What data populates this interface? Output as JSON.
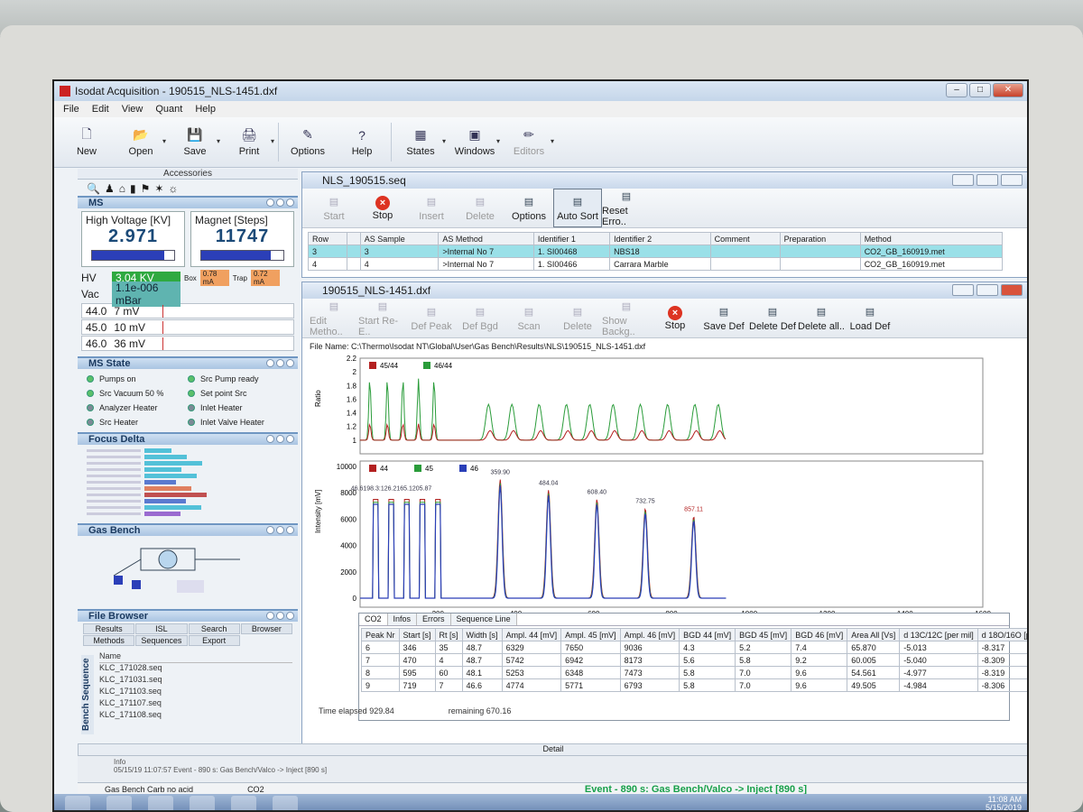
{
  "app": {
    "title": "Isodat Acquisition - 190515_NLS-1451.dxf"
  },
  "menu": [
    "File",
    "Edit",
    "View",
    "Quant",
    "Help"
  ],
  "toolbar": [
    {
      "label": "New",
      "icon": "new-doc-icon",
      "enabled": true
    },
    {
      "label": "Open",
      "icon": "folder-icon",
      "enabled": true
    },
    {
      "label": "Save",
      "icon": "floppy-icon",
      "enabled": true
    },
    {
      "label": "Print",
      "icon": "printer-icon",
      "enabled": true
    },
    {
      "label": "Options",
      "icon": "options-icon",
      "enabled": true
    },
    {
      "label": "Help",
      "icon": "help-icon",
      "enabled": true
    },
    {
      "label": "States",
      "icon": "states-icon",
      "enabled": true
    },
    {
      "label": "Windows",
      "icon": "windows-icon",
      "enabled": true
    },
    {
      "label": "Editors",
      "icon": "pencil-icon",
      "enabled": false
    }
  ],
  "left": {
    "accessories": "Accessories",
    "ms": {
      "title": "MS",
      "hv_label": "High Voltage [KV]",
      "hv_value": "2.971",
      "hv_fill": 0.88,
      "mag_label": "Magnet [Steps]",
      "mag_value": "11747",
      "mag_fill": 0.85,
      "hv_k": "HV",
      "hv_read": "3.04 KV",
      "box_k": "Box",
      "box_v": "0.78 mA",
      "trap_k": "Trap",
      "trap_v": "0.72 mA",
      "vac_k": "Vac",
      "vac_v": "1.1e-006 mBar",
      "lines": [
        {
          "mass": "44.0",
          "val": "7 mV"
        },
        {
          "mass": "45.0",
          "val": "10 mV"
        },
        {
          "mass": "46.0",
          "val": "36 mV"
        }
      ]
    },
    "state": {
      "title": "MS State",
      "items": [
        "Pumps on",
        "Src Pump ready",
        "Src Vacuum 50 %",
        "Set point Src",
        "Analyzer Heater",
        "Inlet Heater",
        "Src Heater",
        "Inlet Valve Heater"
      ]
    },
    "focus": {
      "title": "Focus Delta"
    },
    "gasbench": {
      "title": "Gas Bench"
    },
    "filebrowser": {
      "title": "File Browser",
      "tabs": [
        "Results",
        "ISL",
        "Search",
        "Browser",
        "Methods",
        "Sequences",
        "Export",
        ""
      ],
      "col": "Name",
      "files": [
        "KLC_171028.seq",
        "KLC_171031.seq",
        "KLC_171103.seq",
        "KLC_171107.seq",
        "KLC_171108.seq"
      ],
      "side": "Bench Sequence"
    }
  },
  "seq": {
    "title": "NLS_190515.seq",
    "buttons": [
      {
        "label": "Start",
        "enabled": false
      },
      {
        "label": "Stop",
        "enabled": true
      },
      {
        "label": "Insert",
        "enabled": false
      },
      {
        "label": "Delete",
        "enabled": false
      },
      {
        "label": "Options",
        "enabled": true
      },
      {
        "label": "Auto Sort",
        "enabled": true
      },
      {
        "label": "Reset Erro..",
        "enabled": true
      }
    ],
    "columns": [
      "Row",
      "",
      "AS Sample",
      "AS Method",
      "Identifier 1",
      "Identifier 2",
      "Comment",
      "Preparation",
      "Method"
    ],
    "rows": [
      [
        "3",
        "",
        "3",
        ">Internal No 7",
        "1. SI00468",
        "NBS18",
        "",
        "",
        "CO2_GB_160919.met"
      ],
      [
        "4",
        "",
        "4",
        ">Internal No 7",
        "1. SI00466",
        "Carrara Marble",
        "",
        "",
        "CO2_GB_160919.met"
      ]
    ]
  },
  "res": {
    "title": "190515_NLS-1451.dxf",
    "buttons": [
      {
        "label": "Edit Metho..",
        "enabled": false
      },
      {
        "label": "Start Re-E..",
        "enabled": false
      },
      {
        "label": "Def Peak",
        "enabled": false
      },
      {
        "label": "Def Bgd",
        "enabled": false
      },
      {
        "label": "Scan",
        "enabled": false
      },
      {
        "label": "Delete",
        "enabled": false
      },
      {
        "label": "Show Backg..",
        "enabled": false
      },
      {
        "label": "Stop",
        "enabled": true
      },
      {
        "label": "Save Def",
        "enabled": true
      },
      {
        "label": "Delete Def",
        "enabled": true
      },
      {
        "label": "Delete all..",
        "enabled": true
      },
      {
        "label": "Load Def",
        "enabled": true
      }
    ],
    "filename": "File Name: C:\\Thermo\\Isodat NT\\Global\\User\\Gas Bench\\Results\\NLS\\190515_NLS-1451.dxf",
    "tabs": [
      "CO2",
      "Infos",
      "Errors",
      "Sequence Line"
    ],
    "columns": [
      "Peak Nr",
      "Start [s]",
      "Rt [s]",
      "Width [s]",
      "Ampl. 44 [mV]",
      "Ampl. 45 [mV]",
      "Ampl. 46 [mV]",
      "BGD 44 [mV]",
      "BGD 45 [mV]",
      "BGD 46 [mV]",
      "Area All [Vs]",
      "d 13C/12C [per mil]",
      "d 18O/16O [per mil]"
    ],
    "rows": [
      [
        "6",
        "346",
        "35",
        "48.7",
        "6329",
        "7650",
        "9036",
        "4.3",
        "5.2",
        "7.4",
        "65.870",
        "-5.013",
        "-8.317"
      ],
      [
        "7",
        "470",
        "4",
        "48.7",
        "5742",
        "6942",
        "8173",
        "5.6",
        "5.8",
        "9.2",
        "60.005",
        "-5.040",
        "-8.309"
      ],
      [
        "8",
        "595",
        "60",
        "48.1",
        "5253",
        "6348",
        "7473",
        "5.8",
        "7.0",
        "9.6",
        "54.561",
        "-4.977",
        "-8.319"
      ],
      [
        "9",
        "719",
        "7",
        "46.6",
        "4774",
        "5771",
        "6793",
        "5.8",
        "7.0",
        "9.6",
        "49.505",
        "-4.984",
        "-8.306"
      ]
    ],
    "elapsed_label": "Time elapsed",
    "elapsed": "929.84",
    "remaining_label": "remaining",
    "remaining": "670.16"
  },
  "bottom": {
    "detail": "Detail",
    "info": "Info",
    "log": "05/15/19 11:07:57 Event - 890 s: Gas Bench/Valco -> Inject [890 s]",
    "status_left": "Gas Bench Carb no acid",
    "status_gas": "CO2",
    "event": "Event - 890 s: Gas Bench/Valco -> Inject [890 s]",
    "time": "11:08 AM",
    "date": "5/15/2019"
  },
  "chart_data": [
    {
      "type": "line",
      "ylabel": "Ratio",
      "ylim": [
        0.8,
        2.2
      ],
      "yticks": [
        1.0,
        1.2,
        1.4,
        1.6,
        1.8,
        2.0,
        2.2
      ],
      "xlim": [
        0,
        1600
      ],
      "series": [
        {
          "name": "45/44",
          "color": "#b32020"
        },
        {
          "name": "46/44",
          "color": "#2a9c3a"
        }
      ],
      "ref_peaks_x": [
        25,
        70,
        110,
        150,
        190
      ],
      "sample_peaks_x": [
        330,
        390,
        460,
        530,
        590,
        650,
        720,
        790,
        860,
        920
      ],
      "baseline": 1.0,
      "ratio_45_44_peak": 1.2,
      "ratio_46_44_peak": 1.75
    },
    {
      "type": "line",
      "ylabel": "Intensity [mV]",
      "xlabel": "Time [s]",
      "ylim": [
        0,
        10000
      ],
      "yticks": [
        0,
        2000,
        4000,
        6000,
        8000,
        10000
      ],
      "xlim": [
        0,
        1600
      ],
      "xticks": [
        200,
        400,
        600,
        800,
        1000,
        1200,
        1400,
        1600
      ],
      "series": [
        {
          "name": "44",
          "color": "#b32020"
        },
        {
          "name": "45",
          "color": "#2a9c3a"
        },
        {
          "name": "46",
          "color": "#2a3fb8"
        }
      ],
      "ref_peaks": [
        {
          "x": 40,
          "y": 7500
        },
        {
          "x": 80,
          "y": 7500
        },
        {
          "x": 120,
          "y": 7500
        },
        {
          "x": 160,
          "y": 7500
        },
        {
          "x": 200,
          "y": 7500
        }
      ],
      "sample_peaks": [
        {
          "x": 359.9,
          "y": 9000
        },
        {
          "x": 484.04,
          "y": 8200
        },
        {
          "x": 608.4,
          "y": 7500
        },
        {
          "x": 732.75,
          "y": 6800
        },
        {
          "x": 857.11,
          "y": 6200
        }
      ],
      "annotations": [
        "46.6198.3:126.2165.1205.87",
        "359.90",
        "484.04",
        "608.40",
        "732.75",
        "857.11"
      ]
    }
  ]
}
